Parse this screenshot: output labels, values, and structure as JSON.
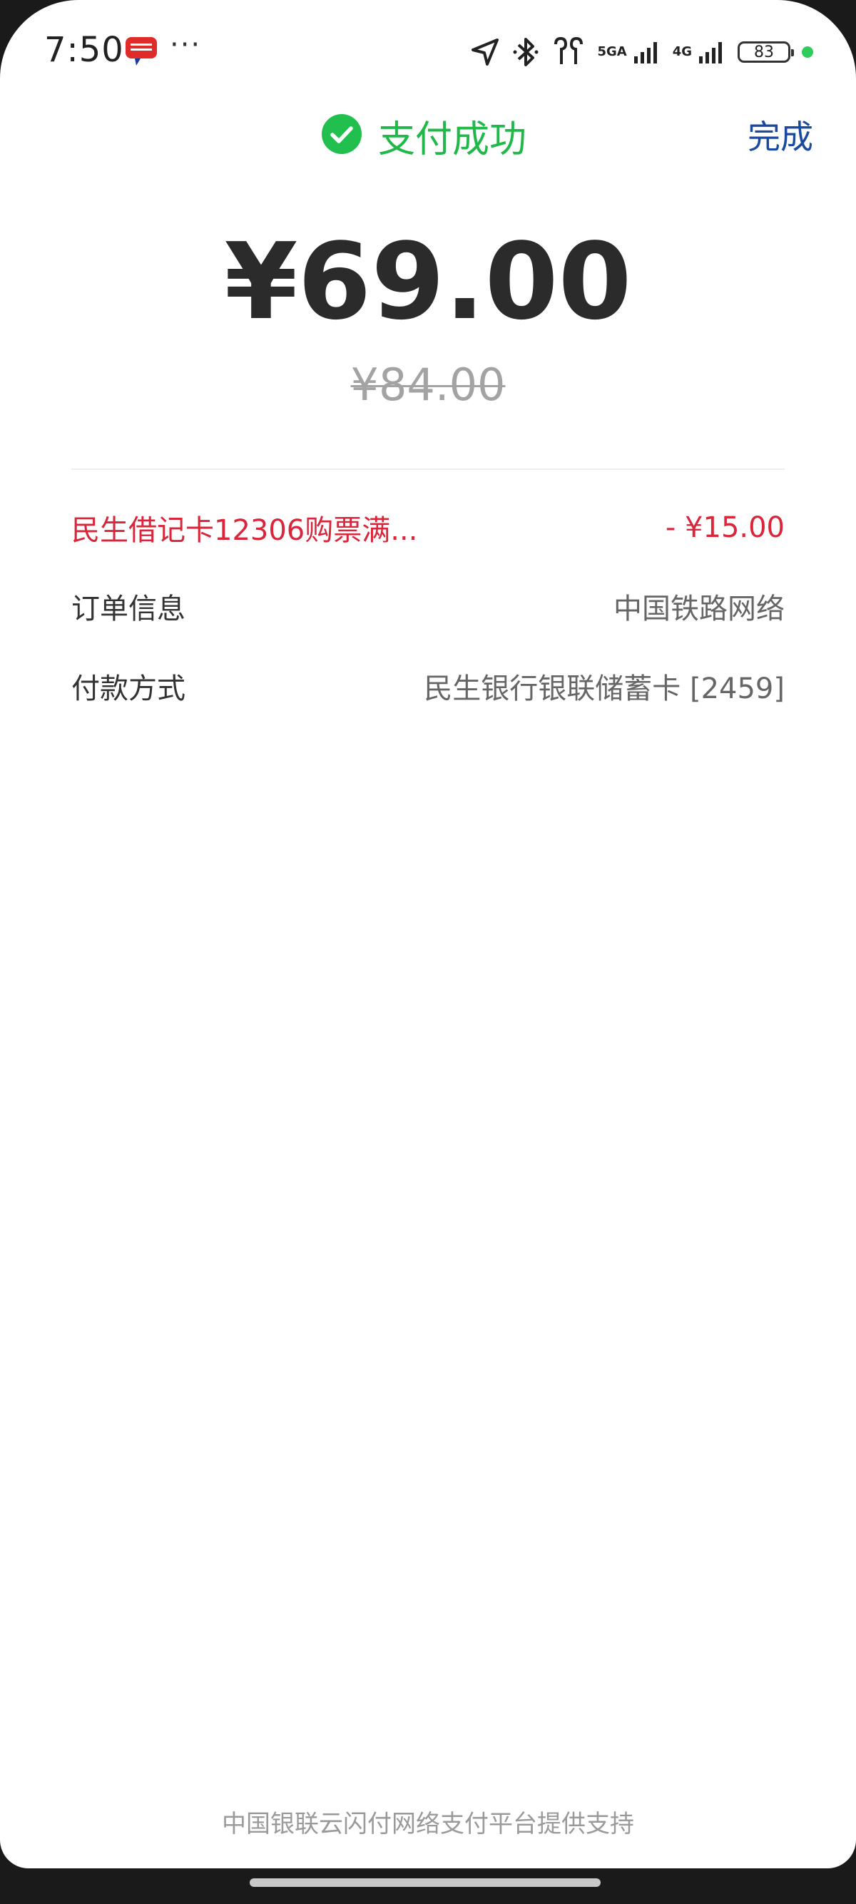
{
  "status_bar": {
    "time": "7:50",
    "more": "···",
    "net1": "5GA",
    "net2": "4G",
    "battery": "83"
  },
  "header": {
    "title": "支付成功",
    "done_label": "完成"
  },
  "payment": {
    "amount": "¥69.00",
    "original_amount": "¥84.00"
  },
  "rows": [
    {
      "label": "民生借记卡12306购票满...",
      "value": "- ¥15.00"
    },
    {
      "label": "订单信息",
      "value": "中国铁路网络"
    },
    {
      "label": "付款方式",
      "value": "民生银行银联储蓄卡 [2459]"
    }
  ],
  "footer": {
    "text": "中国银联云闪付网络支付平台提供支持"
  },
  "colors": {
    "success": "#21b84a",
    "link": "#1a4aa0",
    "discount": "#d9263a"
  }
}
